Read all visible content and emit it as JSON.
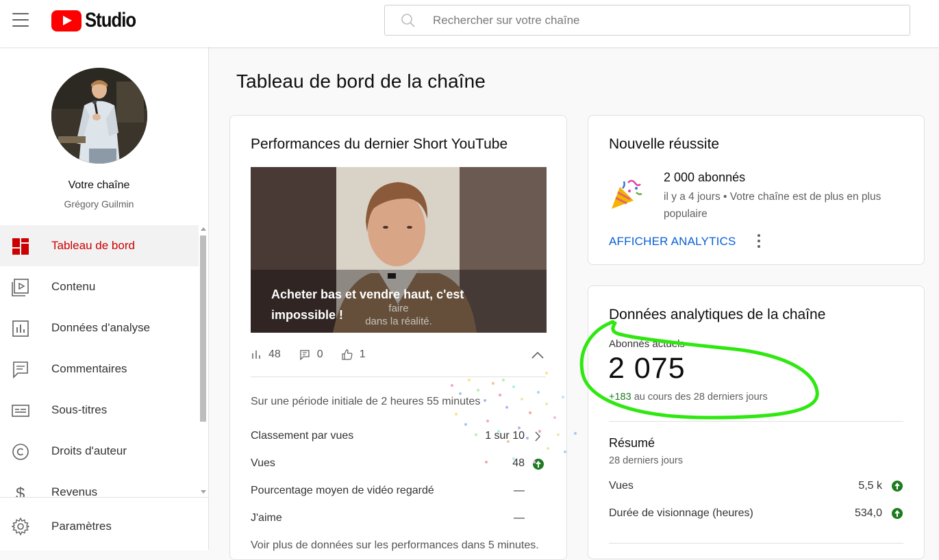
{
  "header": {
    "logo_text": "Studio",
    "search_placeholder": "Rechercher sur votre chaîne"
  },
  "sidebar": {
    "channel_title": "Votre chaîne",
    "channel_name": "Grégory Guilmin",
    "items": [
      {
        "label": "Tableau de bord",
        "icon": "dashboard-icon",
        "active": true
      },
      {
        "label": "Contenu",
        "icon": "content-icon",
        "active": false
      },
      {
        "label": "Données d'analyse",
        "icon": "analytics-icon",
        "active": false
      },
      {
        "label": "Commentaires",
        "icon": "comments-icon",
        "active": false
      },
      {
        "label": "Sous-titres",
        "icon": "subtitles-icon",
        "active": false
      },
      {
        "label": "Droits d'auteur",
        "icon": "copyright-icon",
        "active": false
      },
      {
        "label": "Revenus",
        "icon": "revenue-icon",
        "active": false
      }
    ],
    "settings_label": "Paramètres"
  },
  "main": {
    "page_title": "Tableau de bord de la chaîne",
    "short_card": {
      "title": "Performances du dernier Short YouTube",
      "thumbnail_title": "Acheter bas et vendre haut, c'est impossible !",
      "thumbnail_caption_line1": "faire",
      "thumbnail_caption_line2": "dans la réalité.",
      "views_count": "48",
      "comments_count": "0",
      "likes_count": "1",
      "period_text": "Sur une période initiale de 2 heures 55 minutes",
      "rows": [
        {
          "label": "Classement par vues",
          "value": "1 sur 10"
        },
        {
          "label": "Vues",
          "value": "48"
        },
        {
          "label": "Pourcentage moyen de vidéo regardé",
          "value": "—"
        },
        {
          "label": "J'aime",
          "value": "—"
        }
      ],
      "more_text": "Voir plus de données sur les performances dans 5 minutes."
    },
    "milestone_card": {
      "title": "Nouvelle réussite",
      "milestone": "2 000 abonnés",
      "description": "il y a 4 jours • Votre chaîne est de plus en plus populaire",
      "link_label": "AFFICHER ANALYTICS"
    },
    "analytics_card": {
      "title": "Données analytiques de la chaîne",
      "subscribers_label": "Abonnés actuels",
      "subscribers_count": "2 075",
      "change_plus": "+183",
      "change_text": "au cours des 28 derniers jours",
      "summary_title": "Résumé",
      "summary_period": "28 derniers jours",
      "summary_rows": [
        {
          "label": "Vues",
          "value": "5,5 k"
        },
        {
          "label": "Durée de visionnage (heures)",
          "value": "534,0"
        }
      ]
    }
  },
  "colors": {
    "brand_red": "#ff0000",
    "active_red": "#cc0000",
    "link_blue": "#065fd4",
    "positive_green": "#1e7b20",
    "annotation_green": "#2ee80f"
  }
}
